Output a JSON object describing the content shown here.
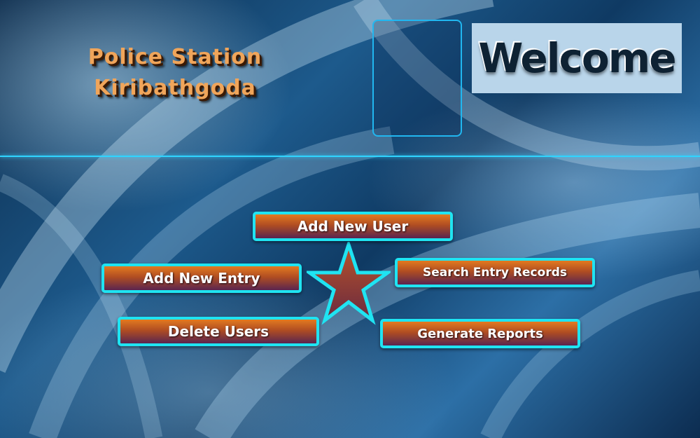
{
  "header": {
    "station_line1": "Police Station",
    "station_line2": "Kiribathgoda",
    "welcome": "Welcome"
  },
  "menu": {
    "add_new_user": "Add New User",
    "add_new_entry": "Add New Entry",
    "search_entry_records": "Search Entry Records",
    "delete_users": "Delete Users",
    "generate_reports": "Generate Reports"
  },
  "icons": {
    "center": "star-icon"
  },
  "colors": {
    "button_border": "#1fe4f2",
    "button_top": "#e27a20",
    "button_bottom": "#5a2550",
    "title_text": "#f0a55a",
    "divider": "#2fd4ff",
    "welcome_bg": "#b9d5ea"
  }
}
